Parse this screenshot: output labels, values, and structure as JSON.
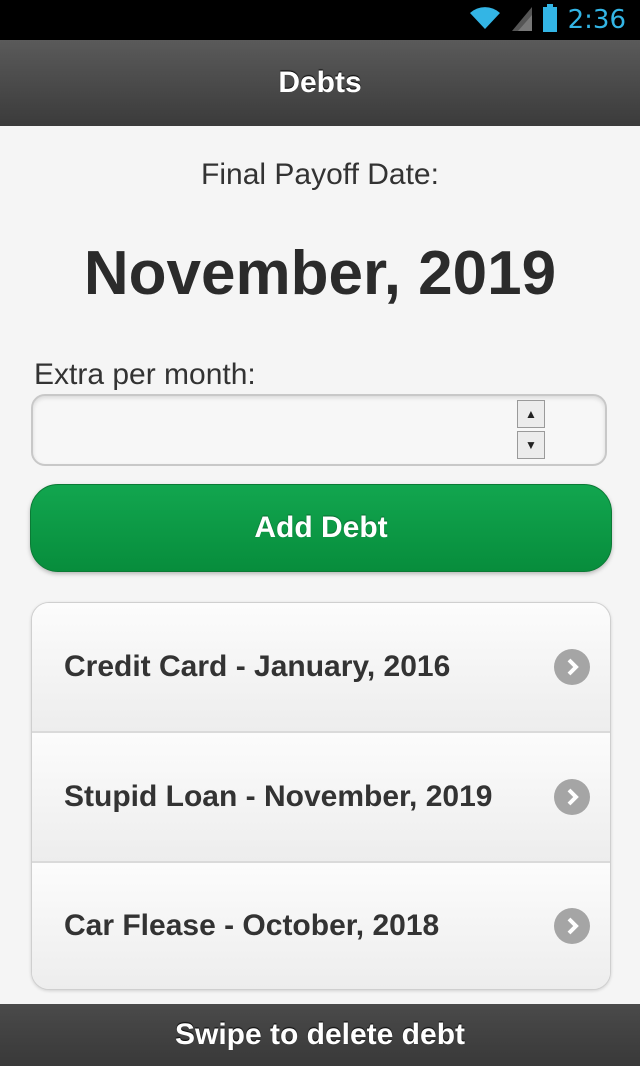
{
  "status_bar": {
    "time": "2:36",
    "icons": [
      "wifi-icon",
      "signal-icon",
      "battery-icon"
    ],
    "color": "#33b5e5"
  },
  "header": {
    "title": "Debts"
  },
  "payoff": {
    "label": "Final Payoff Date:",
    "date": "November, 2019"
  },
  "extra": {
    "label": "Extra per month:",
    "value": ""
  },
  "add_button": {
    "label": "Add Debt",
    "color": "#0a9a45"
  },
  "debts": [
    {
      "label": "Credit Card - January, 2016"
    },
    {
      "label": "Stupid Loan - November, 2019"
    },
    {
      "label": "Car Flease - October, 2018"
    }
  ],
  "footer": {
    "label": "Swipe to delete debt"
  }
}
